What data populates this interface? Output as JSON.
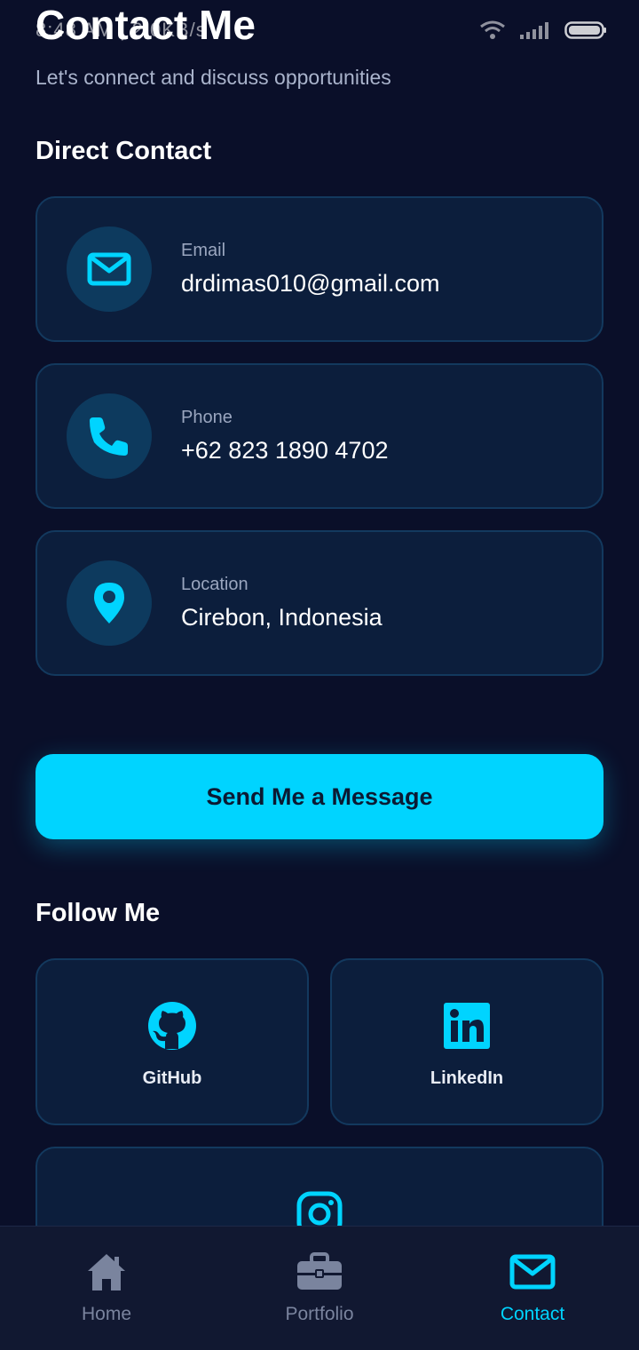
{
  "status_bar": {
    "time": "8:48 AM | 2.0KB/s"
  },
  "header": {
    "title": "Contact Me",
    "subtitle": "Let's connect and discuss opportunities"
  },
  "direct_contact": {
    "title": "Direct Contact",
    "items": [
      {
        "label": "Email",
        "value": "drdimas010@gmail.com",
        "icon": "envelope-icon"
      },
      {
        "label": "Phone",
        "value": "+62 823 1890 4702",
        "icon": "phone-icon"
      },
      {
        "label": "Location",
        "value": "Cirebon, Indonesia",
        "icon": "map-pin-icon"
      }
    ]
  },
  "cta": {
    "label": "Send Me a Message"
  },
  "follow": {
    "title": "Follow Me",
    "items": [
      {
        "label": "GitHub",
        "icon": "github-icon"
      },
      {
        "label": "LinkedIn",
        "icon": "linkedin-icon"
      },
      {
        "label": "",
        "icon": "instagram-icon"
      }
    ]
  },
  "bottom_nav": {
    "items": [
      {
        "label": "Home",
        "icon": "home-icon",
        "active": false
      },
      {
        "label": "Portfolio",
        "icon": "briefcase-icon",
        "active": false
      },
      {
        "label": "Contact",
        "icon": "envelope-icon",
        "active": true
      }
    ]
  },
  "colors": {
    "background": "#0a0f29",
    "card": "#0c1e3c",
    "card_border": "#13395e",
    "accent": "#00d4ff",
    "nav_background": "#111831",
    "nav_inactive": "#7a849e"
  }
}
